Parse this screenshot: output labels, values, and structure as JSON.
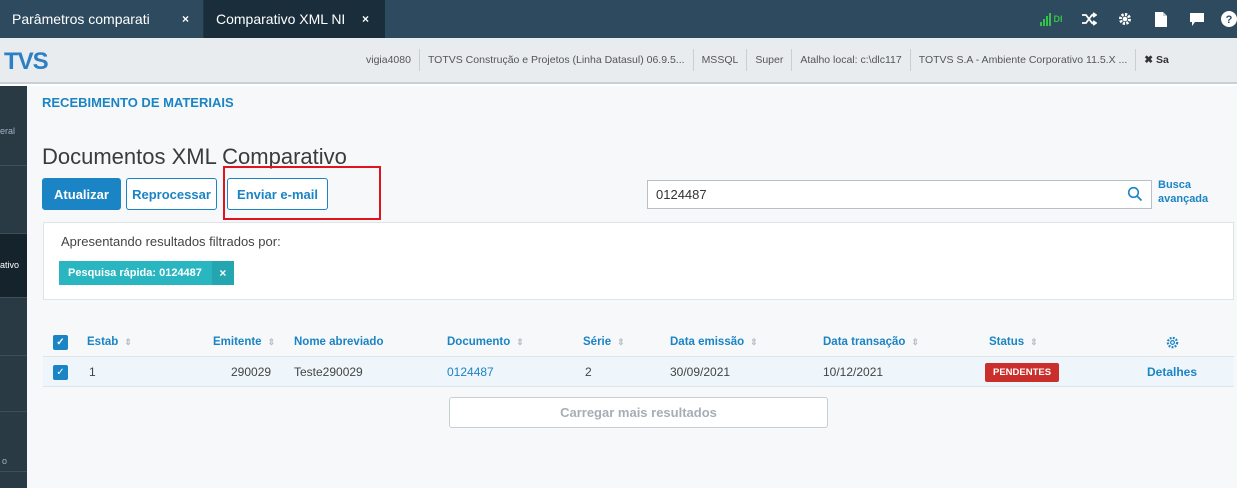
{
  "tabs": [
    {
      "label": "Parâmetros comparati",
      "close": "×"
    },
    {
      "label": "Comparativo XML NF-",
      "close": "×"
    }
  ],
  "top_icons": [
    "signal-icon",
    "shuffle-icon",
    "gear-icon",
    "document-icon",
    "chat-icon",
    "help-icon"
  ],
  "signal_label": "DI",
  "brand": "TVS",
  "info": [
    "vigia4080",
    "TOTVS Construção e Projetos (Linha Datasul) 06.9.5...",
    "MSSQL",
    "Super",
    "Atalho local: c:\\dlc117",
    "TOTVS S.A - Ambiente Corporativo 11.5.X ...",
    "✖ Sa"
  ],
  "leftnav": [
    "eral",
    "",
    "ativo",
    "",
    "",
    "o"
  ],
  "breadcrumb": "RECEBIMENTO DE MATERIAIS",
  "page_title": "Documentos XML Comparativo",
  "buttons": {
    "update": "Atualizar",
    "reprocess": "Reprocessar",
    "email": "Enviar e-mail"
  },
  "search": {
    "value": "0124487"
  },
  "advanced_search": {
    "line1": "Busca",
    "line2": "avançada"
  },
  "filter": {
    "title": "Apresentando resultados filtrados por:",
    "chip": "Pesquisa rápida: 0124487",
    "chip_close": "×"
  },
  "table": {
    "headers": {
      "estab": "Estab",
      "emitente": "Emitente",
      "nome": "Nome abreviado",
      "documento": "Documento",
      "serie": "Série",
      "emissao": "Data emissão",
      "transacao": "Data transação",
      "status": "Status"
    },
    "rows": [
      {
        "estab": "1",
        "emitente": "290029",
        "nome": "Teste290029",
        "documento": "0124487",
        "serie": "2",
        "emissao": "30/09/2021",
        "transacao": "10/12/2021",
        "status": "PENDENTES",
        "action": "Detalhes"
      }
    ]
  },
  "load_more": "Carregar mais resultados",
  "colors": {
    "accent": "#1b84c5",
    "topbar": "#2d4a5e",
    "chip": "#29b6c1",
    "status_pending": "#c9302c",
    "highlight": "#e0141e"
  }
}
